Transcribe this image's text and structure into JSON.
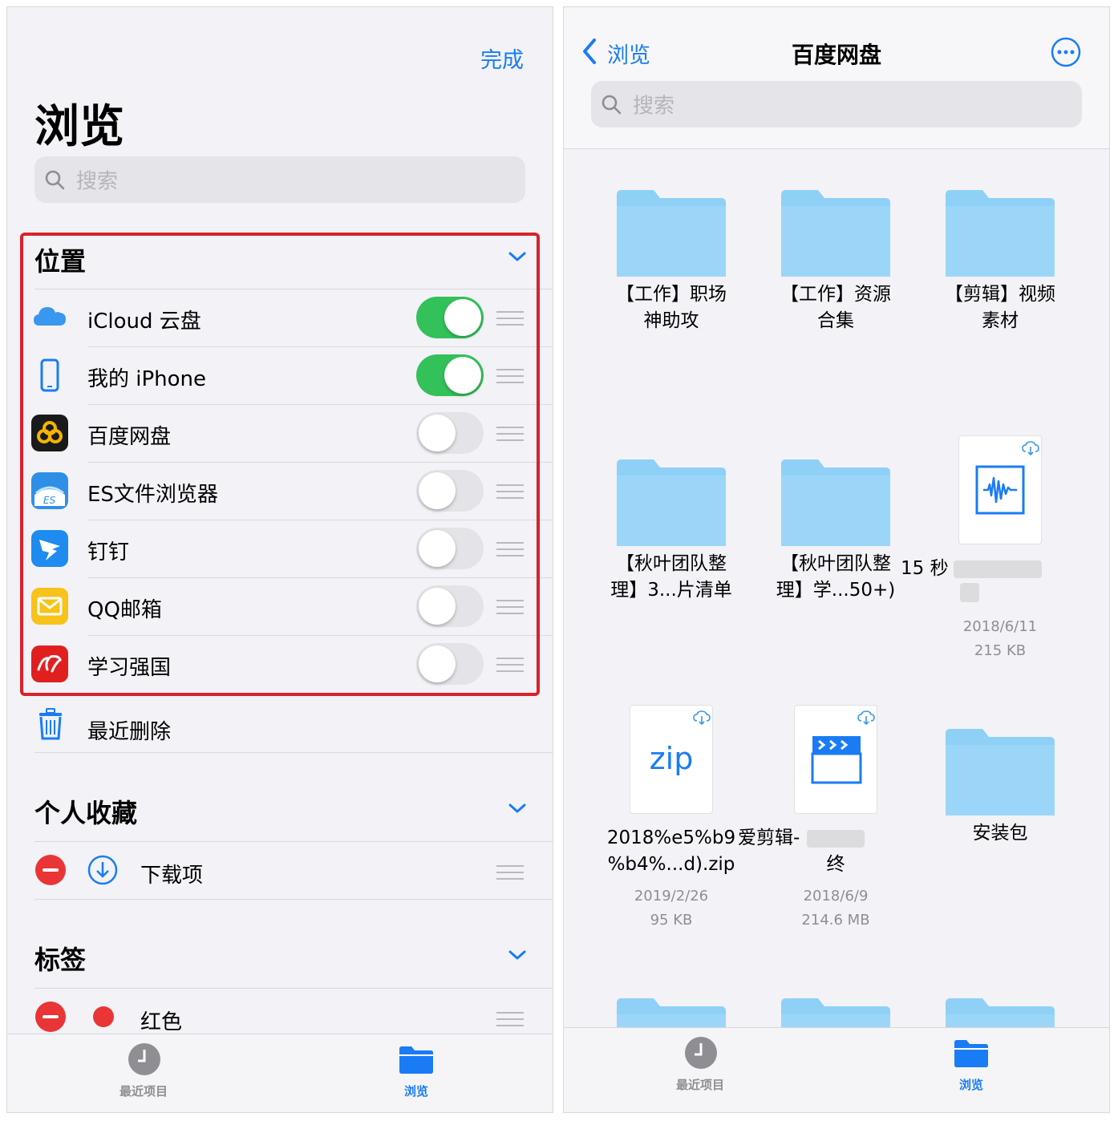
{
  "left": {
    "done_label": "完成",
    "title": "浏览",
    "search_placeholder": "搜索",
    "locations": {
      "header": "位置",
      "items": [
        {
          "label": "iCloud 云盘",
          "enabled": true,
          "icon": "icloud-icon"
        },
        {
          "label": "我的 iPhone",
          "enabled": true,
          "icon": "iphone-icon"
        },
        {
          "label": "百度网盘",
          "enabled": false,
          "icon": "baidu-netdisk-icon"
        },
        {
          "label": "ES文件浏览器",
          "enabled": false,
          "icon": "es-file-explorer-icon"
        },
        {
          "label": "钉钉",
          "enabled": false,
          "icon": "dingtalk-icon"
        },
        {
          "label": "QQ邮箱",
          "enabled": false,
          "icon": "qq-mail-icon"
        },
        {
          "label": "学习强国",
          "enabled": false,
          "icon": "xuexi-qiangguo-icon"
        }
      ],
      "recently_deleted": "最近删除"
    },
    "favorites": {
      "header": "个人收藏",
      "items": [
        {
          "label": "下载项"
        }
      ]
    },
    "tags": {
      "header": "标签",
      "items": [
        {
          "label": "红色",
          "color": "#e93535"
        }
      ]
    },
    "tabs": [
      {
        "label": "最近项目",
        "active": false
      },
      {
        "label": "浏览",
        "active": true
      }
    ]
  },
  "right": {
    "back_label": "浏览",
    "title": "百度网盘",
    "search_placeholder": "搜索",
    "files": [
      {
        "name_line1": "【工作】职场",
        "name_line2": "神助攻",
        "kind": "folder"
      },
      {
        "name_line1": "【工作】资源",
        "name_line2": "合集",
        "kind": "folder"
      },
      {
        "name_line1": "【剪辑】视频",
        "name_line2": "素材",
        "kind": "folder"
      },
      {
        "name_line1": "【秋叶团队整",
        "name_line2": "理】3...片清单",
        "kind": "folder"
      },
      {
        "name_line1": "【秋叶团队整",
        "name_line2": "理】学...50+)",
        "kind": "folder"
      },
      {
        "name_line1": "15 秒",
        "date": "2018/6/11",
        "size": "215 KB",
        "kind": "audio"
      },
      {
        "name_line1": "2018%e5%b9",
        "name_line2": "%b4%...d).zip",
        "date": "2019/2/26",
        "size": "95 KB",
        "kind": "zip",
        "badge": "zip"
      },
      {
        "name_line1": "爱剪辑-",
        "name_line2": "终",
        "date": "2018/6/9",
        "size": "214.6 MB",
        "kind": "video"
      },
      {
        "name_line1": "安装包",
        "kind": "folder"
      }
    ],
    "tabs": [
      {
        "label": "最近项目",
        "active": false
      },
      {
        "label": "浏览",
        "active": true
      }
    ]
  },
  "colors": {
    "accent": "#1a7cf5",
    "toggle_on": "#33c15a",
    "highlight": "#d8222a",
    "folder": "#8fd0f7"
  }
}
